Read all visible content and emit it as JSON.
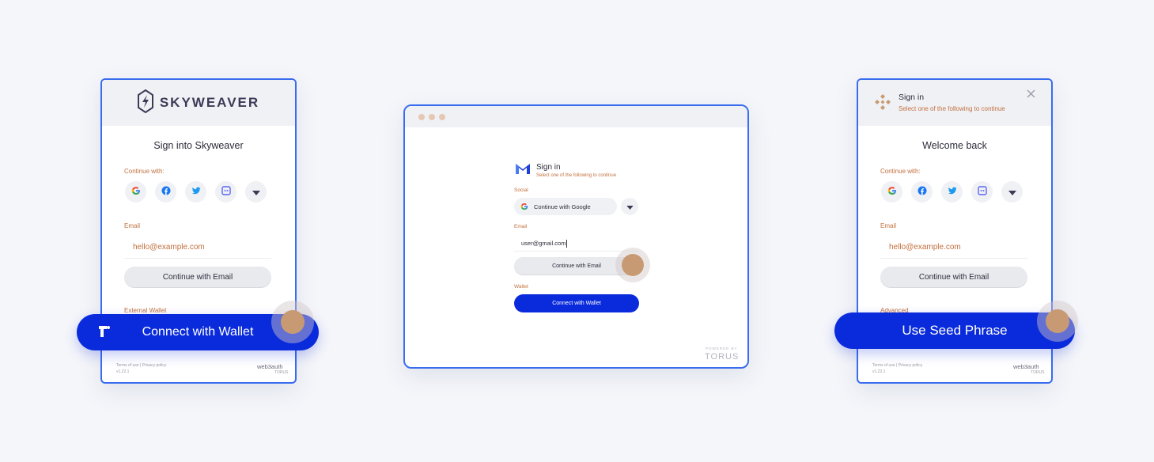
{
  "left_card": {
    "brand": "SKYWEAVER",
    "title": "Sign into Skyweaver",
    "continue_label": "Continue with:",
    "email_label": "Email",
    "email_placeholder": "hello@example.com",
    "continue_email": "Continue with Email",
    "external_wallet_label": "External Wallet",
    "connect_wallet": "Connect with Wallet",
    "footer_links": "Terms of use  |  Privacy policy",
    "footer_version": "v1.22.1",
    "web3auth": "web3auth",
    "torus": "TORUS"
  },
  "center_card": {
    "title": "Sign in",
    "subtitle": "Select one of the following to continue",
    "social_label": "Social",
    "google_button": "Continue with Google",
    "email_label": "Email",
    "email_value": "user@gmail.com",
    "continue_email": "Continue with Email",
    "wallet_label": "Wallet",
    "connect_wallet": "Connect with Wallet",
    "powered_by": "POWERED BY",
    "torus": "TORUS"
  },
  "right_card": {
    "title": "Sign in",
    "subtitle": "Select one of the following to continue",
    "welcome": "Welcome back",
    "continue_label": "Continue with:",
    "email_label": "Email",
    "email_placeholder": "hello@example.com",
    "continue_email": "Continue with Email",
    "advanced_label": "Advanced",
    "seed_phrase": "Use Seed Phrase",
    "footer_links": "Terms of use  |  Privacy policy",
    "footer_version": "v1.22.1",
    "web3auth": "web3auth",
    "torus": "TORUS"
  },
  "colors": {
    "accent": "#0a2bdc",
    "border": "#3a6cf0",
    "label": "#c2703e"
  }
}
